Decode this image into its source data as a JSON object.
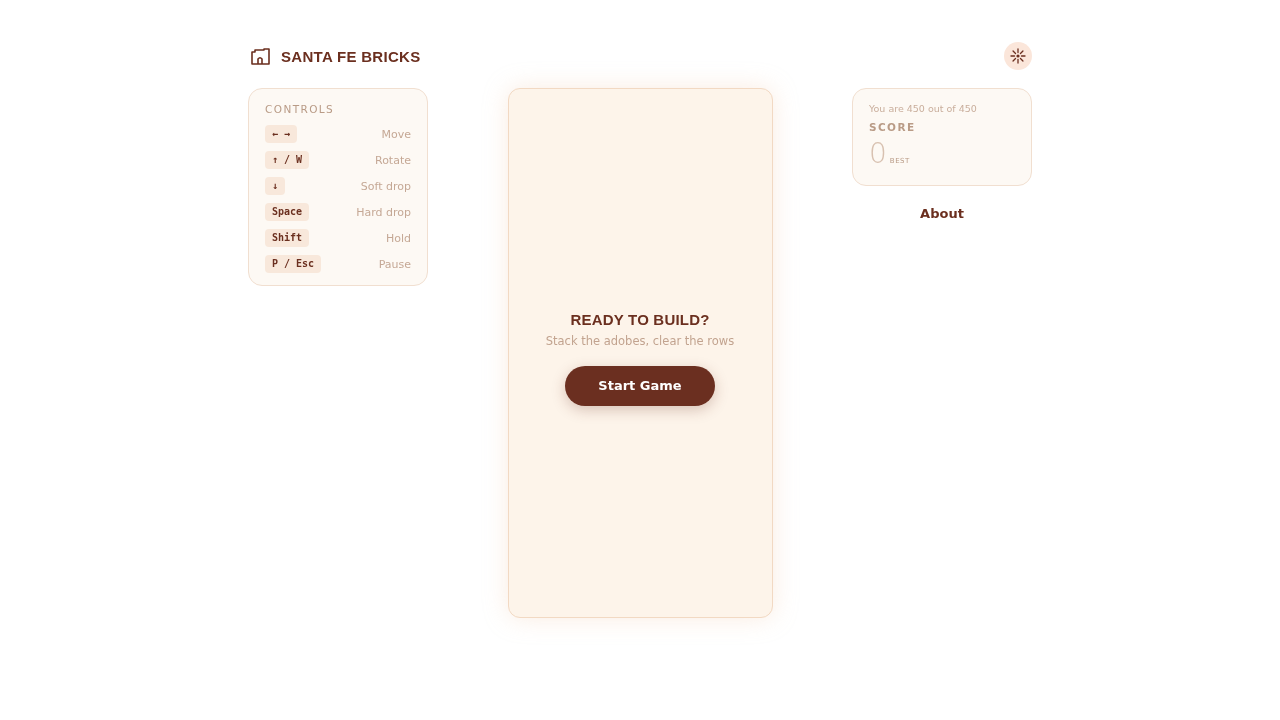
{
  "header": {
    "title": "SANTA FE BRICKS"
  },
  "controls": {
    "title": "CONTROLS",
    "rows": [
      {
        "keys": "← →",
        "action": "Move"
      },
      {
        "keys": "↑ / W",
        "action": "Rotate"
      },
      {
        "keys": "↓",
        "action": "Soft drop"
      },
      {
        "keys": "Space",
        "action": "Hard drop"
      },
      {
        "keys": "Shift",
        "action": "Hold"
      },
      {
        "keys": "P / Esc",
        "action": "Pause"
      }
    ]
  },
  "board": {
    "title": "READY TO BUILD?",
    "subtitle": "Stack the adobes, clear the rows",
    "button": "Start Game"
  },
  "score": {
    "rank": "You are 450 out of 450",
    "title": "SCORE",
    "value": "0",
    "best_label": "BEST"
  },
  "about": "About"
}
